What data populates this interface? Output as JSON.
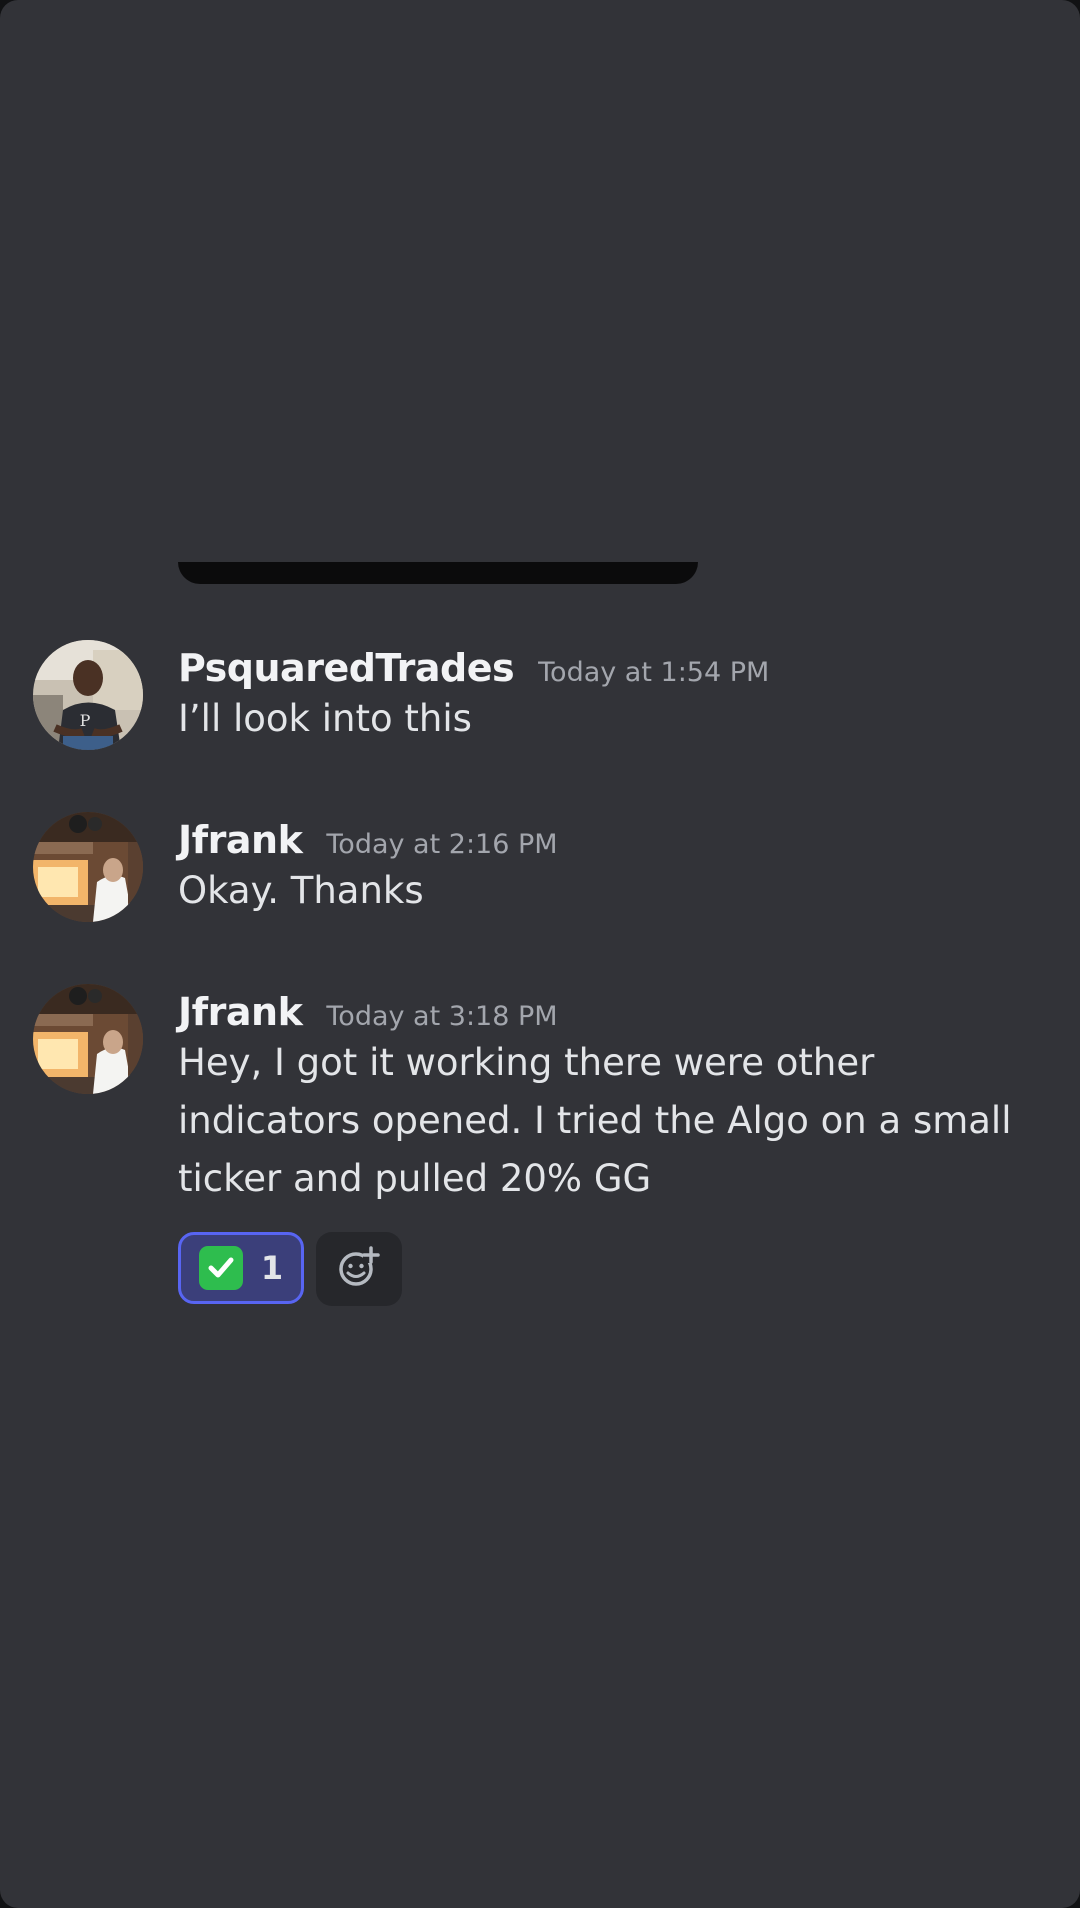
{
  "messages": [
    {
      "username": "PsquaredTrades",
      "timestamp": "Today at 1:54 PM",
      "text": "I’ll look into this",
      "avatar": "psquared-avatar"
    },
    {
      "username": "Jfrank",
      "timestamp": "Today at 2:16 PM",
      "text": "Okay. Thanks",
      "avatar": "jfrank-avatar"
    },
    {
      "username": "Jfrank",
      "timestamp": "Today at 3:18 PM",
      "text_lines": [
        "Hey, I got it working there were other",
        "indicators opened. I tried the Algo on a small",
        "ticker and pulled 20% GG"
      ],
      "avatar": "jfrank-avatar",
      "reactions": [
        {
          "emoji": "white-check-mark",
          "count": "1",
          "selected": true
        }
      ],
      "add_reaction_icon": "add-reaction-icon"
    }
  ],
  "colors": {
    "background": "#323338",
    "username": "#f2f3f5",
    "timestamp": "#a3a6ad",
    "text": "#e3e5e8",
    "reaction_border": "#5865f2",
    "reaction_bg": "#3b3f7a",
    "check_green": "#2ebd4e"
  }
}
